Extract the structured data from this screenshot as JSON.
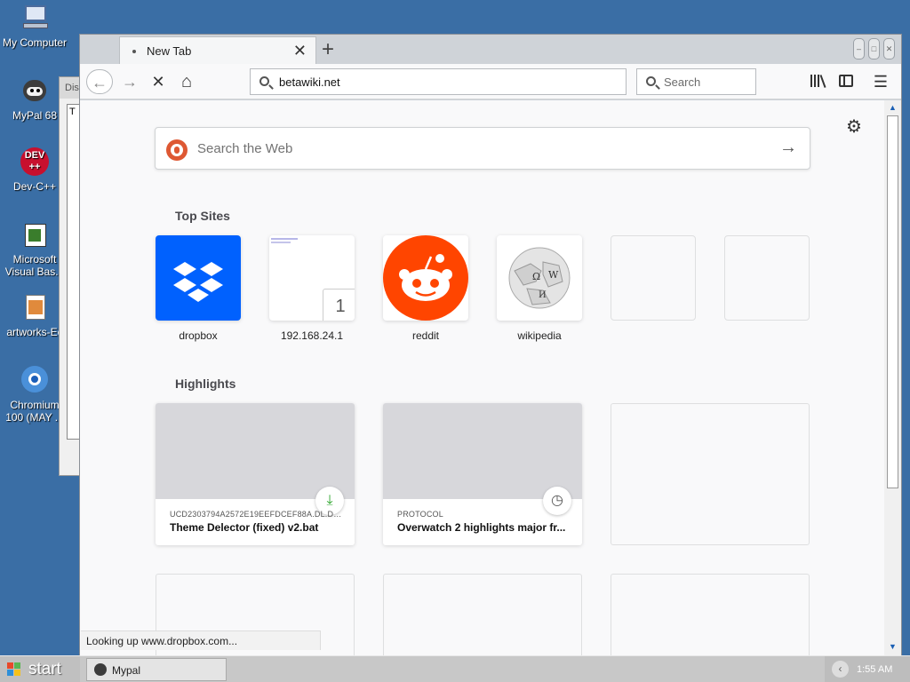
{
  "desktop": {
    "icons": [
      {
        "label": "My Computer"
      },
      {
        "label": "MyPal 68"
      },
      {
        "label": "Dev-C++"
      },
      {
        "label": "Microsoft Visual Bas..."
      },
      {
        "label": "artworks-Ec"
      },
      {
        "label": "Chromium 100 (MAY ..."
      }
    ],
    "bg_window": {
      "title": "Dis",
      "body": "T"
    }
  },
  "browser": {
    "tab": {
      "title": "New Tab",
      "close": "✕"
    },
    "new_tab": "+",
    "window_controls": [
      "‒",
      "□",
      "✕"
    ],
    "nav": {
      "back": "←",
      "forward": "→",
      "stop": "✕",
      "home": "⌂",
      "url": "betawiki.net",
      "search_placeholder": "Search",
      "library_icon": "library-icon",
      "sidebar_icon": "sidebar-icon",
      "menu": "☰"
    },
    "newtab_page": {
      "settings": "⚙",
      "web_search_placeholder": "Search the Web",
      "go": "→",
      "top_sites_title": "Top Sites",
      "top_sites": [
        {
          "name": "dropbox",
          "brand": "#0061fe"
        },
        {
          "name": "192.168.24.1",
          "badge": "1"
        },
        {
          "name": "reddit",
          "brand": "#ff4500"
        },
        {
          "name": "wikipedia"
        }
      ],
      "highlights_title": "Highlights",
      "highlights": [
        {
          "host": "UCD2303794A2572E19EEFDCEF88A.DL.DR...",
          "title": "Theme Delector (fixed) v2.bat",
          "icon": "download-icon",
          "icon_glyph": "⤓"
        },
        {
          "host": "PROTOCOL",
          "title": "Overwatch 2 highlights major fr...",
          "icon": "history-icon",
          "icon_glyph": "◷"
        }
      ]
    },
    "status": "Looking up www.dropbox.com..."
  },
  "taskbar": {
    "start": "start",
    "tasks": [
      {
        "label": "Mypal"
      }
    ],
    "tray_chevron": "‹",
    "clock": "1:55 AM"
  }
}
